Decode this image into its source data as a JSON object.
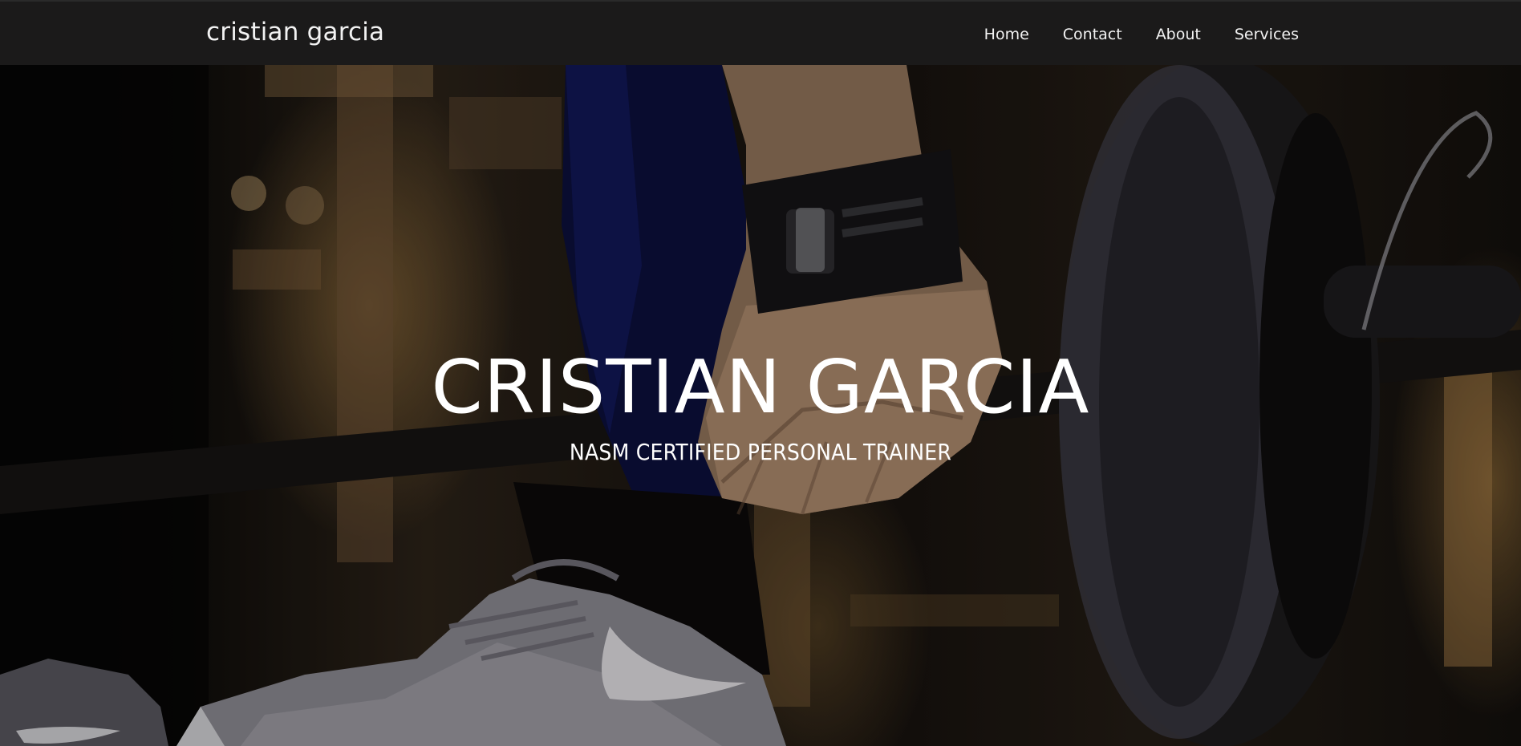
{
  "navbar": {
    "brand": "cristian garcia",
    "links": [
      {
        "label": "Home"
      },
      {
        "label": "Contact"
      },
      {
        "label": "About"
      },
      {
        "label": "Services"
      }
    ],
    "background_color": "#1b1a1a"
  },
  "hero": {
    "title": "CRISTIAN GARCIA",
    "subtitle": "NASM CERTIFIED PERSONAL TRAINER",
    "image_description_icon": "gym-barbell-photo"
  }
}
